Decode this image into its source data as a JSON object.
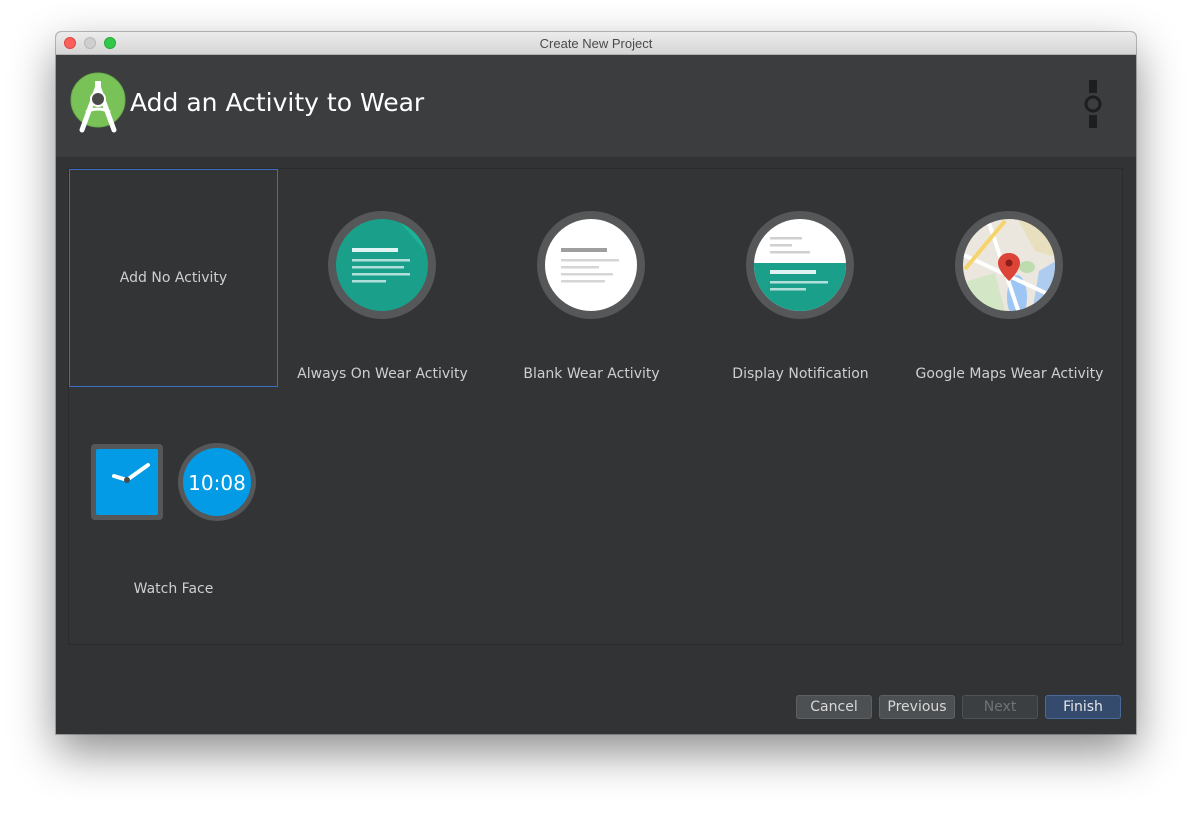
{
  "window": {
    "title": "Create New Project"
  },
  "header": {
    "title": "Add an Activity to Wear"
  },
  "gallery": {
    "items": [
      {
        "label": "Add No Activity",
        "selected": true
      },
      {
        "label": "Always On Wear Activity"
      },
      {
        "label": "Blank Wear Activity"
      },
      {
        "label": "Display Notification"
      },
      {
        "label": "Google Maps Wear Activity"
      },
      {
        "label": "Watch Face",
        "clock_text": "10:08"
      }
    ]
  },
  "buttons": {
    "cancel": "Cancel",
    "previous": "Previous",
    "next": "Next",
    "finish": "Finish"
  },
  "colors": {
    "accent_selected": "#3f6cc3",
    "android_green": "#78c257",
    "teal": "#1aa08a",
    "watch_blue": "#039be5"
  }
}
